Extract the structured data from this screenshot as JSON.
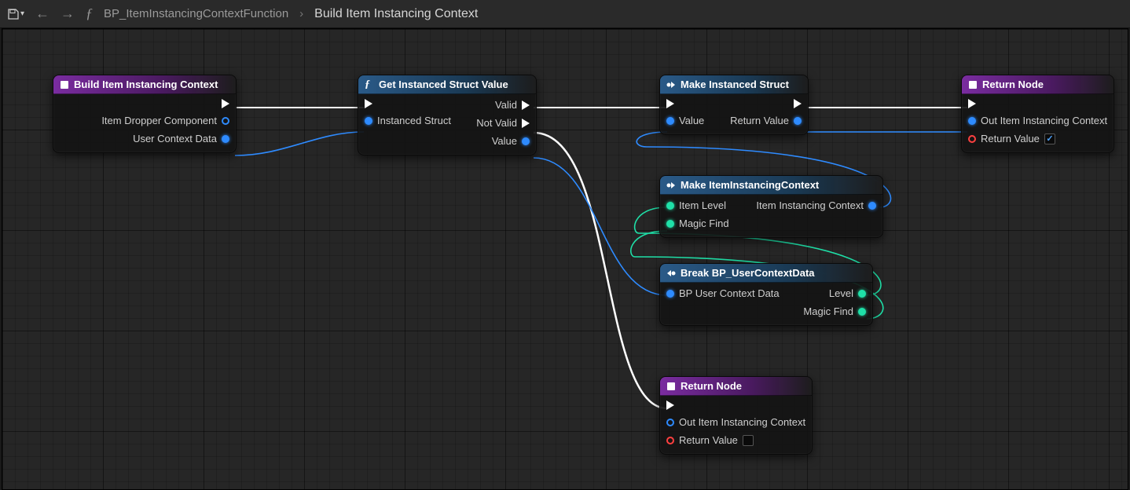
{
  "toolbar": {
    "parent": "BP_ItemInstancingContextFunction",
    "current": "Build Item Instancing Context"
  },
  "nodes": {
    "start": {
      "title": "Build Item Instancing Context",
      "pins": {
        "dropper": "Item Dropper Component",
        "userctx": "User Context Data"
      }
    },
    "getval": {
      "title": "Get Instanced Struct Value",
      "pins": {
        "struct": "Instanced Struct",
        "valid": "Valid",
        "notvalid": "Not Valid",
        "value": "Value"
      }
    },
    "makestruct": {
      "title": "Make Instanced Struct",
      "pins": {
        "value": "Value",
        "retval": "Return Value"
      }
    },
    "makectx": {
      "title": "Make ItemInstancingContext",
      "pins": {
        "level": "Item Level",
        "magic": "Magic Find",
        "out": "Item Instancing Context"
      }
    },
    "breakctx": {
      "title": "Break BP_UserContextData",
      "pins": {
        "in": "BP User Context Data",
        "level": "Level",
        "magic": "Magic Find"
      }
    },
    "ret1": {
      "title": "Return Node",
      "pins": {
        "ctx": "Out Item Instancing Context",
        "retval": "Return Value"
      }
    },
    "ret2": {
      "title": "Return Node",
      "pins": {
        "ctx": "Out Item Instancing Context",
        "retval": "Return Value"
      }
    }
  }
}
